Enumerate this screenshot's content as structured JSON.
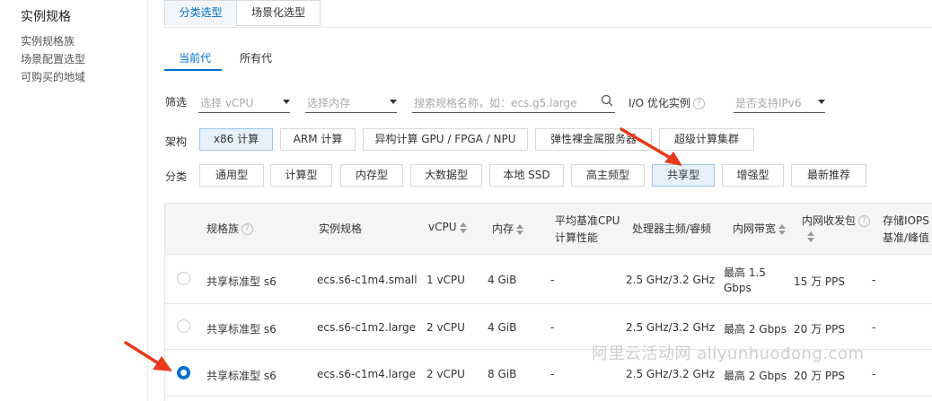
{
  "sidebar": {
    "title": "实例规格",
    "links": [
      "实例规格族",
      "场景配置选型",
      "可购买的地域"
    ]
  },
  "top_tabs": [
    "分类选型",
    "场景化选型"
  ],
  "sub_tabs": [
    "当前代",
    "所有代"
  ],
  "filter": {
    "label": "筛选",
    "vcpu_placeholder": "选择 vCPU",
    "memory_placeholder": "选择内存",
    "search_placeholder": "搜索规格名称，如：ecs.g5.large",
    "io_label": "I/O 优化实例",
    "ipv6_placeholder": "是否支持IPv6"
  },
  "arch": {
    "label": "架构",
    "options": [
      "x86 计算",
      "ARM 计算",
      "异构计算 GPU / FPGA / NPU",
      "弹性裸金属服务器",
      "超级计算集群"
    ]
  },
  "category": {
    "label": "分类",
    "options": [
      "通用型",
      "计算型",
      "内存型",
      "大数据型",
      "本地 SSD",
      "高主频型",
      "共享型",
      "增强型",
      "最新推荐"
    ]
  },
  "table": {
    "headers": {
      "family": "规格族",
      "spec": "实例规格",
      "vcpu": "vCPU",
      "memory": "内存",
      "baseline_line1": "平均基准CPU",
      "baseline_line2": "计算性能",
      "processor": "处理器主频/睿频",
      "bandwidth": "内网带宽",
      "pps": "内网收发包",
      "iops_line1": "存储IOPS",
      "iops_line2": "基准/峰值"
    },
    "rows": [
      {
        "family": "共享标准型 s6",
        "spec": "ecs.s6-c1m4.small",
        "vcpu": "1 vCPU",
        "memory": "4 GiB",
        "baseline": "-",
        "processor": "2.5 GHz/3.2 GHz",
        "bandwidth_line1": "最高 1.5",
        "bandwidth_line2": "Gbps",
        "pps": "15 万 PPS",
        "iops": "-",
        "selected": false
      },
      {
        "family": "共享标准型 s6",
        "spec": "ecs.s6-c1m2.large",
        "vcpu": "2 vCPU",
        "memory": "4 GiB",
        "baseline": "-",
        "processor": "2.5 GHz/3.2 GHz",
        "bandwidth_line1": "最高 2 Gbps",
        "bandwidth_line2": "",
        "pps": "20 万 PPS",
        "iops": "-",
        "selected": false
      },
      {
        "family": "共享标准型 s6",
        "spec": "ecs.s6-c1m4.large",
        "vcpu": "2 vCPU",
        "memory": "8 GiB",
        "baseline": "-",
        "processor": "2.5 GHz/3.2 GHz",
        "bandwidth_line1": "最高 2 Gbps",
        "bandwidth_line2": "",
        "pps": "20 万 PPS",
        "iops": "-",
        "selected": true
      }
    ]
  },
  "watermark": "阿里云活动网 aliyunhuodong.com",
  "colors": {
    "accent": "#0070cc",
    "arrow": "#e8391a",
    "active_bg": "#e6f1fb"
  }
}
